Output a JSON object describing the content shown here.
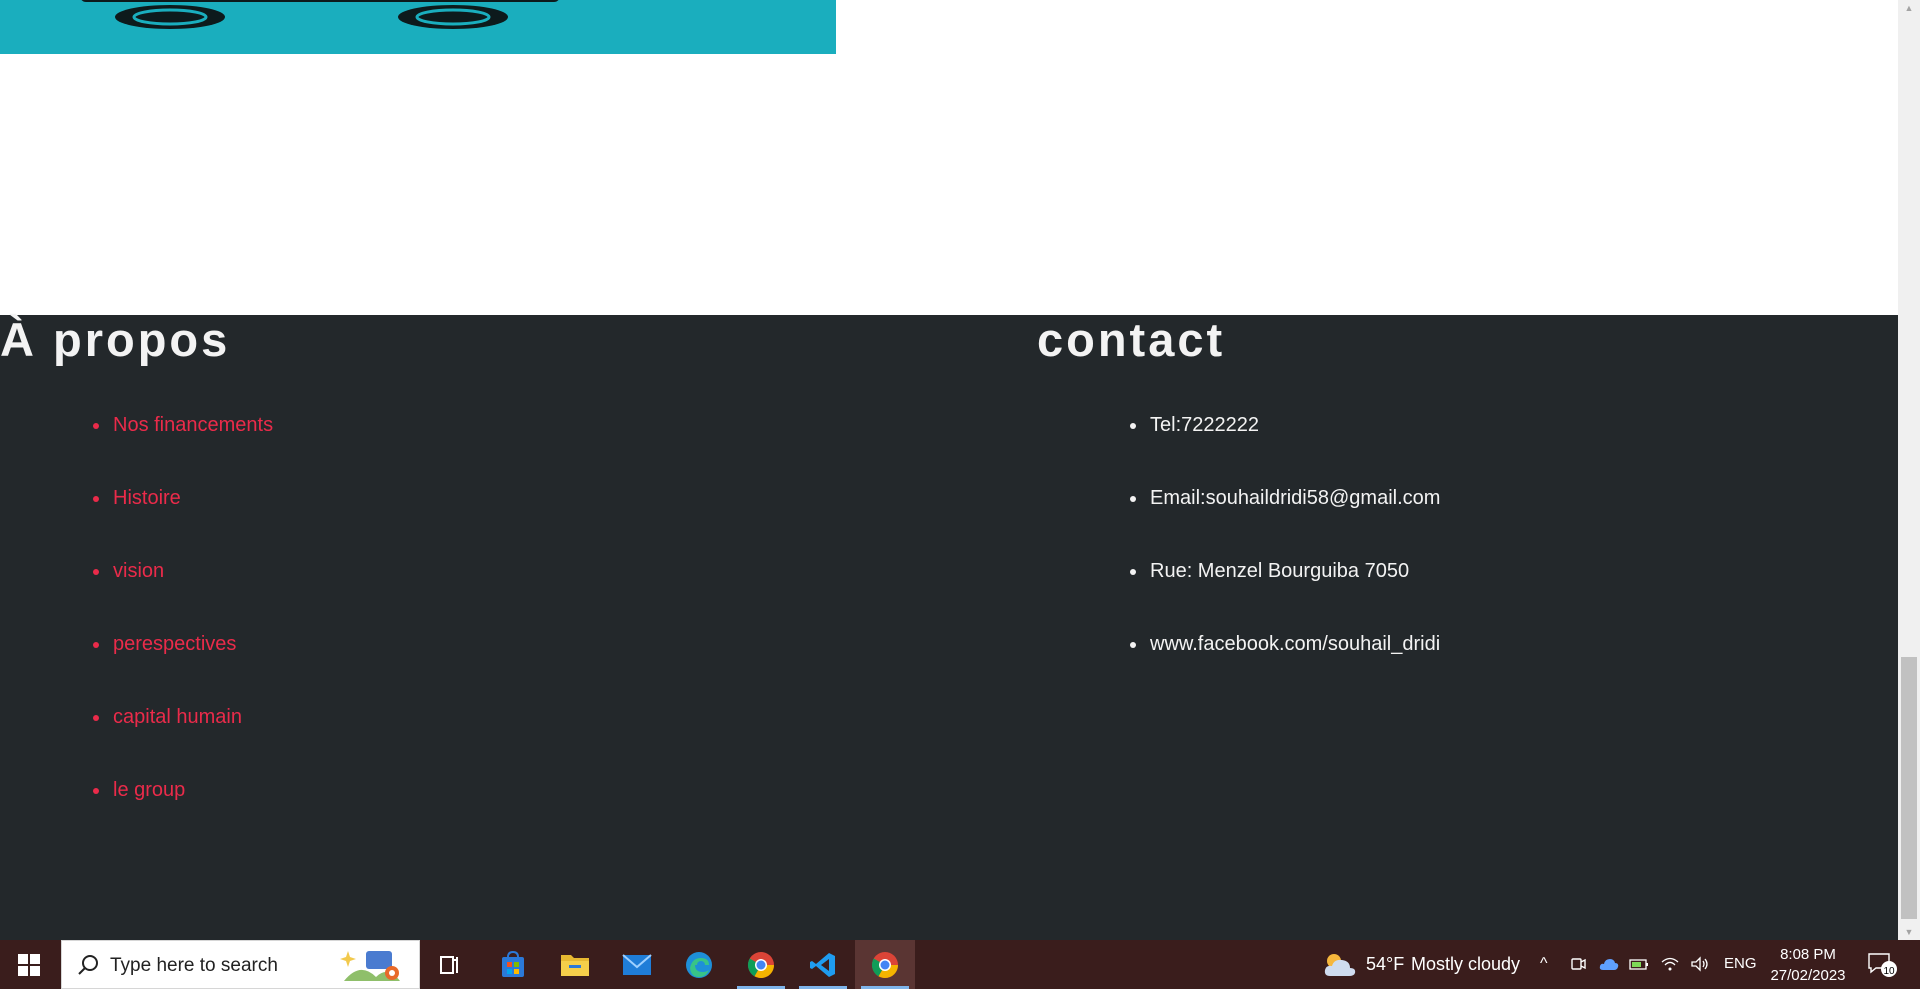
{
  "footer": {
    "about": {
      "title": "À propos",
      "items": [
        "Nos financements",
        "Histoire",
        "vision",
        "perespectives",
        "capital humain",
        "le group"
      ]
    },
    "contact": {
      "title": "contact",
      "items": [
        "Tel:7222222",
        "Email:souhaildridi58@gmail.com",
        "Rue: Menzel Bourguiba 7050",
        "www.facebook.com/souhail_dridi"
      ]
    }
  },
  "colors": {
    "footer_bg": "#23282b",
    "link_red": "#ea2b4a",
    "hero_teal": "#1aaebe",
    "taskbar_bg": "#3a1d1c"
  },
  "taskbar": {
    "search_placeholder": "Type here to search",
    "apps": [
      "windows-start-icon",
      "task-view-icon",
      "microsoft-store-icon",
      "file-explorer-icon",
      "mail-icon",
      "edge-icon",
      "chrome-icon",
      "vscode-icon",
      "chrome-icon"
    ],
    "weather": {
      "temp": "54°F",
      "desc": "Mostly cloudy"
    },
    "language": "ENG",
    "time": "8:08 PM",
    "date": "27/02/2023",
    "notifications_count": "10"
  }
}
